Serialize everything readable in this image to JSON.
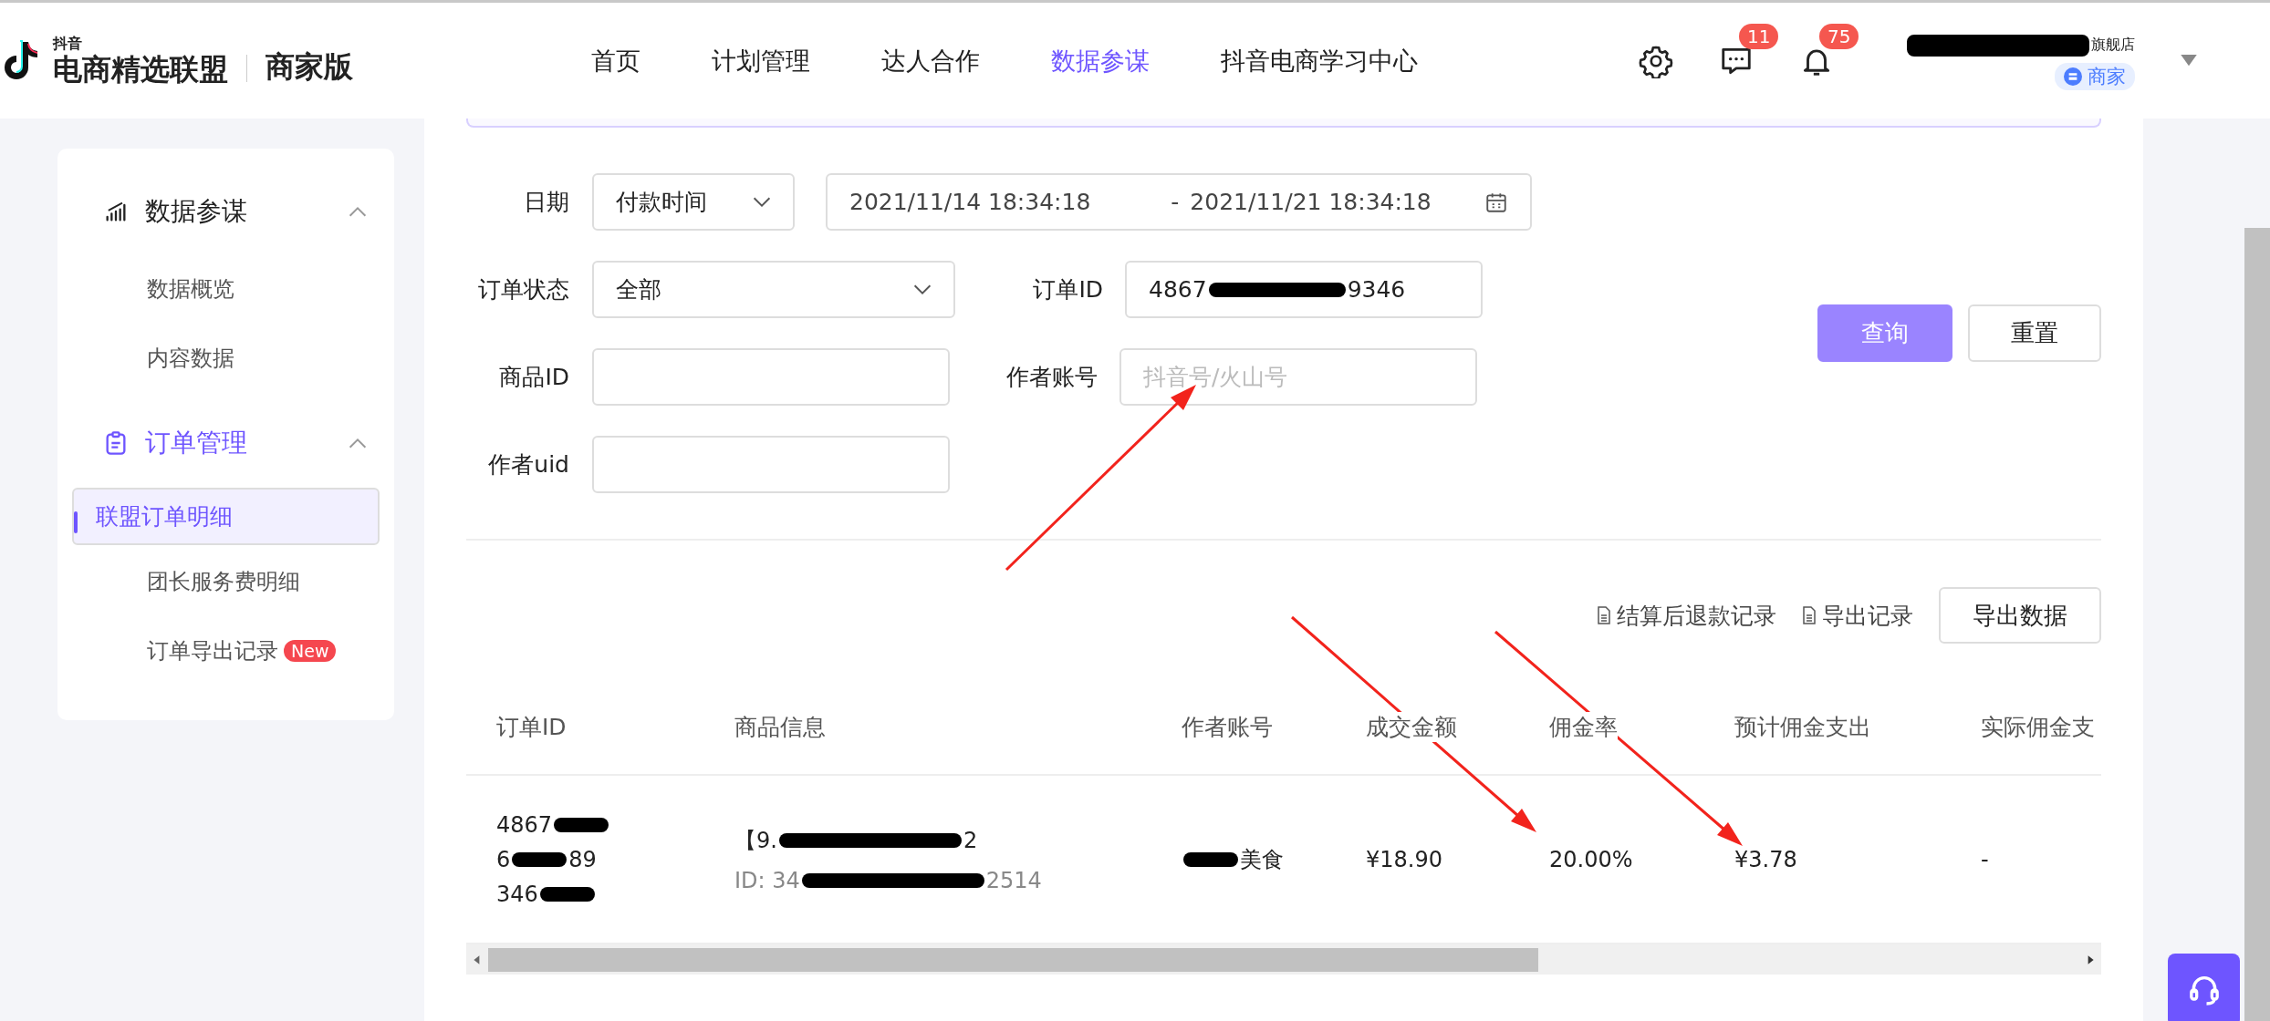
{
  "header": {
    "logo_small": "抖音",
    "logo_title": "电商精选联盟",
    "logo_edition": "商家版",
    "nav": [
      {
        "label": "首页",
        "selected": false
      },
      {
        "label": "计划管理",
        "selected": false
      },
      {
        "label": "达人合作",
        "selected": false
      },
      {
        "label": "数据参谋",
        "selected": true
      },
      {
        "label": "抖音电商学习中心",
        "selected": false
      }
    ],
    "message_badge": "11",
    "notification_badge": "75",
    "user_name": {
      "after": "旗舰店"
    },
    "user_tag": "商家"
  },
  "sidebar": {
    "groups": [
      {
        "title": "数据参谋",
        "active": false,
        "expanded": true,
        "items": [
          {
            "label": "数据概览",
            "selected": false
          },
          {
            "label": "内容数据",
            "selected": false
          }
        ]
      },
      {
        "title": "订单管理",
        "active": true,
        "expanded": true,
        "items": [
          {
            "label": "联盟订单明细",
            "selected": true
          },
          {
            "label": "团长服务费明细",
            "selected": false
          },
          {
            "label": "订单导出记录",
            "selected": false,
            "badge": "New"
          }
        ]
      }
    ]
  },
  "filters": {
    "date_label": "日期",
    "date_type": "付款时间",
    "date_start": "2021/11/14 18:34:18",
    "date_separator": "-",
    "date_end": "2021/11/21 18:34:18",
    "status_label": "订单状态",
    "status_value": "全部",
    "order_id_label": "订单ID",
    "order_id_value": {
      "before": "4867",
      "after": "9346"
    },
    "product_id_label": "商品ID",
    "author_label": "作者账号",
    "author_placeholder": "抖音号/火山号",
    "uid_label": "作者uid",
    "buttons": [
      {
        "label": "查询",
        "kind": "primary"
      },
      {
        "label": "重置",
        "kind": "default"
      }
    ]
  },
  "actions": {
    "links": [
      "结算后退款记录",
      "导出记录"
    ],
    "export_button": "导出数据"
  },
  "table": {
    "columns": [
      "订单ID",
      "商品信息",
      "作者账号",
      "成交金额",
      "佣金率",
      "预计佣金支出",
      "实际佣金支"
    ],
    "rows": [
      {
        "order_id": [
          {
            "before": "4867"
          },
          {
            "before": "6",
            "after": "89"
          },
          {
            "before": "346"
          }
        ],
        "product_title": {
          "before": "【9.",
          "after": "2"
        },
        "product_id": {
          "before": "ID: 34",
          "after": "2514"
        },
        "author": {
          "after": "美食"
        },
        "amount": "¥18.90",
        "rate": "20.00%",
        "estimated": "¥3.78",
        "actual": "-"
      }
    ]
  }
}
